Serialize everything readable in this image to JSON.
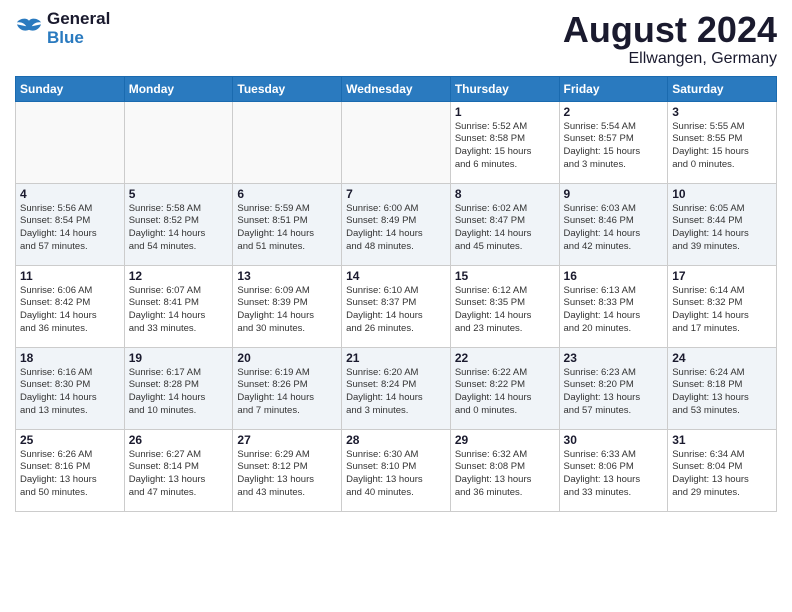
{
  "header": {
    "logo_line1": "General",
    "logo_line2": "Blue",
    "title": "August 2024",
    "subtitle": "Ellwangen, Germany"
  },
  "days_of_week": [
    "Sunday",
    "Monday",
    "Tuesday",
    "Wednesday",
    "Thursday",
    "Friday",
    "Saturday"
  ],
  "weeks": [
    {
      "days": [
        {
          "date": "",
          "info": ""
        },
        {
          "date": "",
          "info": ""
        },
        {
          "date": "",
          "info": ""
        },
        {
          "date": "",
          "info": ""
        },
        {
          "date": "1",
          "info": "Sunrise: 5:52 AM\nSunset: 8:58 PM\nDaylight: 15 hours\nand 6 minutes."
        },
        {
          "date": "2",
          "info": "Sunrise: 5:54 AM\nSunset: 8:57 PM\nDaylight: 15 hours\nand 3 minutes."
        },
        {
          "date": "3",
          "info": "Sunrise: 5:55 AM\nSunset: 8:55 PM\nDaylight: 15 hours\nand 0 minutes."
        }
      ]
    },
    {
      "days": [
        {
          "date": "4",
          "info": "Sunrise: 5:56 AM\nSunset: 8:54 PM\nDaylight: 14 hours\nand 57 minutes."
        },
        {
          "date": "5",
          "info": "Sunrise: 5:58 AM\nSunset: 8:52 PM\nDaylight: 14 hours\nand 54 minutes."
        },
        {
          "date": "6",
          "info": "Sunrise: 5:59 AM\nSunset: 8:51 PM\nDaylight: 14 hours\nand 51 minutes."
        },
        {
          "date": "7",
          "info": "Sunrise: 6:00 AM\nSunset: 8:49 PM\nDaylight: 14 hours\nand 48 minutes."
        },
        {
          "date": "8",
          "info": "Sunrise: 6:02 AM\nSunset: 8:47 PM\nDaylight: 14 hours\nand 45 minutes."
        },
        {
          "date": "9",
          "info": "Sunrise: 6:03 AM\nSunset: 8:46 PM\nDaylight: 14 hours\nand 42 minutes."
        },
        {
          "date": "10",
          "info": "Sunrise: 6:05 AM\nSunset: 8:44 PM\nDaylight: 14 hours\nand 39 minutes."
        }
      ]
    },
    {
      "days": [
        {
          "date": "11",
          "info": "Sunrise: 6:06 AM\nSunset: 8:42 PM\nDaylight: 14 hours\nand 36 minutes."
        },
        {
          "date": "12",
          "info": "Sunrise: 6:07 AM\nSunset: 8:41 PM\nDaylight: 14 hours\nand 33 minutes."
        },
        {
          "date": "13",
          "info": "Sunrise: 6:09 AM\nSunset: 8:39 PM\nDaylight: 14 hours\nand 30 minutes."
        },
        {
          "date": "14",
          "info": "Sunrise: 6:10 AM\nSunset: 8:37 PM\nDaylight: 14 hours\nand 26 minutes."
        },
        {
          "date": "15",
          "info": "Sunrise: 6:12 AM\nSunset: 8:35 PM\nDaylight: 14 hours\nand 23 minutes."
        },
        {
          "date": "16",
          "info": "Sunrise: 6:13 AM\nSunset: 8:33 PM\nDaylight: 14 hours\nand 20 minutes."
        },
        {
          "date": "17",
          "info": "Sunrise: 6:14 AM\nSunset: 8:32 PM\nDaylight: 14 hours\nand 17 minutes."
        }
      ]
    },
    {
      "days": [
        {
          "date": "18",
          "info": "Sunrise: 6:16 AM\nSunset: 8:30 PM\nDaylight: 14 hours\nand 13 minutes."
        },
        {
          "date": "19",
          "info": "Sunrise: 6:17 AM\nSunset: 8:28 PM\nDaylight: 14 hours\nand 10 minutes."
        },
        {
          "date": "20",
          "info": "Sunrise: 6:19 AM\nSunset: 8:26 PM\nDaylight: 14 hours\nand 7 minutes."
        },
        {
          "date": "21",
          "info": "Sunrise: 6:20 AM\nSunset: 8:24 PM\nDaylight: 14 hours\nand 3 minutes."
        },
        {
          "date": "22",
          "info": "Sunrise: 6:22 AM\nSunset: 8:22 PM\nDaylight: 14 hours\nand 0 minutes."
        },
        {
          "date": "23",
          "info": "Sunrise: 6:23 AM\nSunset: 8:20 PM\nDaylight: 13 hours\nand 57 minutes."
        },
        {
          "date": "24",
          "info": "Sunrise: 6:24 AM\nSunset: 8:18 PM\nDaylight: 13 hours\nand 53 minutes."
        }
      ]
    },
    {
      "days": [
        {
          "date": "25",
          "info": "Sunrise: 6:26 AM\nSunset: 8:16 PM\nDaylight: 13 hours\nand 50 minutes."
        },
        {
          "date": "26",
          "info": "Sunrise: 6:27 AM\nSunset: 8:14 PM\nDaylight: 13 hours\nand 47 minutes."
        },
        {
          "date": "27",
          "info": "Sunrise: 6:29 AM\nSunset: 8:12 PM\nDaylight: 13 hours\nand 43 minutes."
        },
        {
          "date": "28",
          "info": "Sunrise: 6:30 AM\nSunset: 8:10 PM\nDaylight: 13 hours\nand 40 minutes."
        },
        {
          "date": "29",
          "info": "Sunrise: 6:32 AM\nSunset: 8:08 PM\nDaylight: 13 hours\nand 36 minutes."
        },
        {
          "date": "30",
          "info": "Sunrise: 6:33 AM\nSunset: 8:06 PM\nDaylight: 13 hours\nand 33 minutes."
        },
        {
          "date": "31",
          "info": "Sunrise: 6:34 AM\nSunset: 8:04 PM\nDaylight: 13 hours\nand 29 minutes."
        }
      ]
    }
  ]
}
